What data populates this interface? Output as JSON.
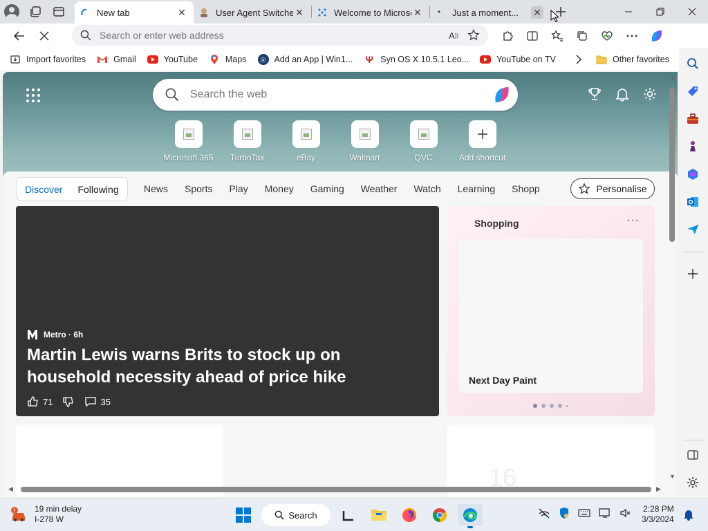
{
  "tabs": [
    {
      "title": "New tab",
      "active": true
    },
    {
      "title": "User Agent Switcher",
      "active": false
    },
    {
      "title": "Welcome to Microsoft",
      "active": false
    },
    {
      "title": "Just a moment...",
      "active": false
    }
  ],
  "address": {
    "placeholder": "Search or enter web address"
  },
  "favorites": [
    {
      "label": "Import favorites"
    },
    {
      "label": "Gmail"
    },
    {
      "label": "YouTube"
    },
    {
      "label": "Maps"
    },
    {
      "label": "Add an App | Win1..."
    },
    {
      "label": "Syn OS X 10.5.1 Leo..."
    },
    {
      "label": "YouTube on TV"
    }
  ],
  "other_favorites": "Other favorites",
  "search": {
    "placeholder": "Search the web"
  },
  "shortcuts": [
    {
      "label": "Microsoft 365"
    },
    {
      "label": "TurboTax"
    },
    {
      "label": "eBay"
    },
    {
      "label": "Walmart"
    },
    {
      "label": "QVC"
    },
    {
      "label": "Add shortcut"
    }
  ],
  "feed_tabs": {
    "discover": "Discover",
    "following": "Following"
  },
  "categories": [
    "News",
    "Sports",
    "Play",
    "Money",
    "Gaming",
    "Weather",
    "Watch",
    "Learning",
    "Shopp"
  ],
  "personalise": "Personalise",
  "hero_article": {
    "source": "Metro · 6h",
    "title": "Martin Lewis warns Brits to stock up on household necessity ahead of price hike",
    "likes": "71",
    "comments": "35"
  },
  "shopping": {
    "title": "Shopping",
    "more": "···",
    "product": "Next Day Paint",
    "dots": 5,
    "active_dot": 0
  },
  "card3_number": "16",
  "taskbar": {
    "weather_line1": "19 min delay",
    "weather_line2": "I-278 W",
    "search_label": "Search",
    "time": "2:28 PM",
    "date": "3/3/2024"
  },
  "colors": {
    "accent": "#0f6cbd",
    "hero_card": "#333333",
    "shopping_bg": "#fbe8ee"
  }
}
